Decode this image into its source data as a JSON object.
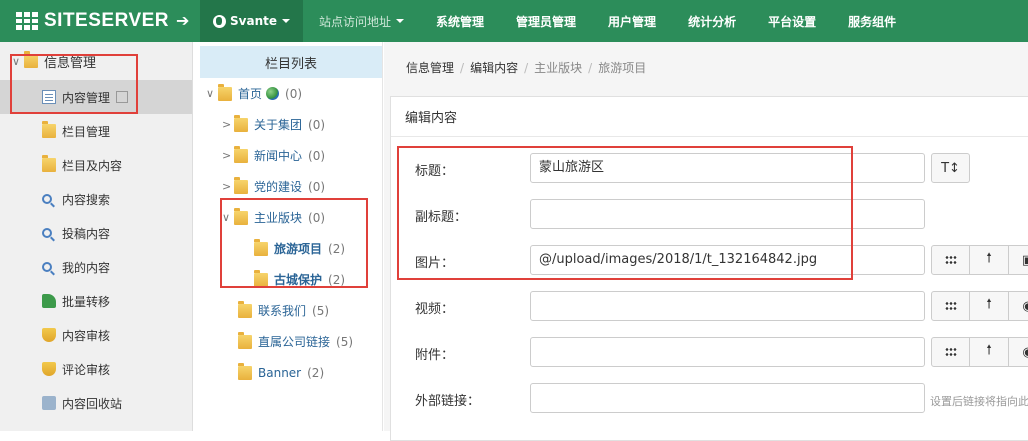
{
  "header": {
    "brand": "SITESERVER",
    "site_label": "Svante",
    "nav": [
      {
        "label": "站点访问地址",
        "dropdown": true
      },
      {
        "label": "系统管理"
      },
      {
        "label": "管理员管理"
      },
      {
        "label": "用户管理"
      },
      {
        "label": "统计分析"
      },
      {
        "label": "平台设置"
      },
      {
        "label": "服务组件"
      }
    ],
    "colors": {
      "bar": "#2c8d5a",
      "active": "#23764a"
    }
  },
  "sidebar": {
    "group": "信息管理",
    "items": [
      {
        "label": "内容管理",
        "icon": "document-icon",
        "active": true
      },
      {
        "label": "栏目管理",
        "icon": "folder-icon"
      },
      {
        "label": "栏目及内容",
        "icon": "folder-icon"
      },
      {
        "label": "内容搜索",
        "icon": "search-icon"
      },
      {
        "label": "投稿内容",
        "icon": "search-icon"
      },
      {
        "label": "我的内容",
        "icon": "search-icon"
      },
      {
        "label": "批量转移",
        "icon": "transfer-arrow-icon"
      },
      {
        "label": "内容审核",
        "icon": "shield-icon"
      },
      {
        "label": "评论审核",
        "icon": "shield-icon"
      },
      {
        "label": "内容回收站",
        "icon": "recycle-bin-icon"
      }
    ]
  },
  "tree": {
    "title": "栏目列表",
    "nodes": [
      {
        "label": "首页",
        "count": "(0)",
        "expanded": true
      },
      {
        "label": "关于集团",
        "count": "(0)"
      },
      {
        "label": "新闻中心",
        "count": "(0)"
      },
      {
        "label": "党的建设",
        "count": "(0)"
      },
      {
        "label": "主业版块",
        "count": "(0)",
        "expanded": true
      },
      {
        "label": "旅游项目",
        "count": "(2)",
        "selected": true
      },
      {
        "label": "古城保护",
        "count": "(2)"
      },
      {
        "label": "联系我们",
        "count": "(5)"
      },
      {
        "label": "直属公司链接",
        "count": "(5)"
      },
      {
        "label": "Banner",
        "count": "(2)"
      }
    ]
  },
  "breadcrumb": [
    "信息管理",
    "编辑内容",
    "主业版块",
    "旅游项目"
  ],
  "panel": {
    "title": "编辑内容",
    "fields": [
      {
        "label": "标题：",
        "value": "蒙山旅游区"
      },
      {
        "label": "副标题：",
        "value": ""
      },
      {
        "label": "图片：",
        "value": "@/upload/images/2018/1/t_132164842.jpg"
      },
      {
        "label": "视频：",
        "value": ""
      },
      {
        "label": "附件：",
        "value": ""
      },
      {
        "label": "外部链接：",
        "value": ""
      }
    ],
    "title_tool": "T↕",
    "external_link_hint": "设置后链接将指向此"
  }
}
